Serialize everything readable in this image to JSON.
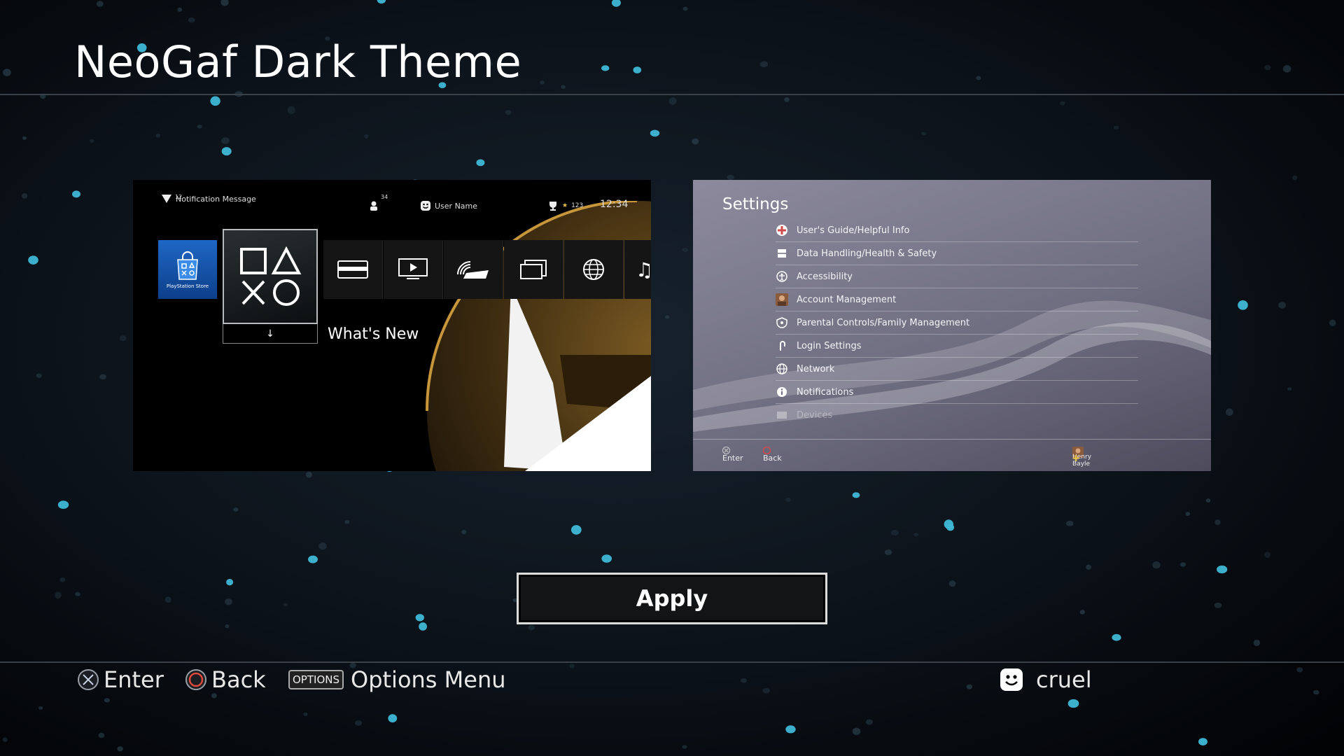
{
  "theme": {
    "title": "NeoGaf Dark Theme"
  },
  "home_preview": {
    "notification_count": "12",
    "notification_label": "Notification Message",
    "friends_count": "34",
    "user_name": "User Name",
    "trophy_count": "123",
    "clock": "12:34",
    "store_label": "PlayStation Store",
    "selected_label": "What's New"
  },
  "settings_preview": {
    "title": "Settings",
    "items": [
      "User's Guide/Helpful Info",
      "Data Handling/Health & Safety",
      "Accessibility",
      "Account Management",
      "Parental Controls/Family Management",
      "Login Settings",
      "Network",
      "Notifications",
      "Devices"
    ],
    "footer_enter": "Enter",
    "footer_back": "Back",
    "footer_user": "Henry Bayle"
  },
  "apply": {
    "label": "Apply"
  },
  "hints": {
    "enter": "Enter",
    "back": "Back",
    "options_badge": "OPTIONS",
    "options": "Options Menu"
  },
  "user": {
    "name": "cruel"
  },
  "colors": {
    "background": "#05080c",
    "particle": "#3fb8d6",
    "button_border": "#dcdcdc"
  }
}
